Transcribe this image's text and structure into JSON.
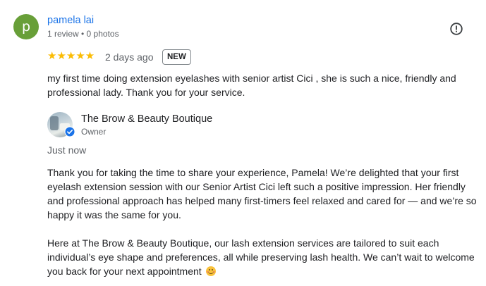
{
  "review": {
    "reviewer": {
      "initial": "p",
      "name": "pamela lai",
      "meta": "1 review • 0 photos",
      "avatar_color": "#689f38"
    },
    "rating": 5,
    "stars": "★★★★★",
    "date": "2 days ago",
    "badge": "NEW",
    "text": "my first time doing extension eyelashes with senior artist Cici , she is such a nice, friendly and professional lady. Thank you for your service.",
    "report_icon": "report-alert-icon"
  },
  "owner_reply": {
    "business_name": "The Brow & Beauty Boutique",
    "role": "Owner",
    "verified_icon": "verified-check-icon",
    "date": "Just now",
    "paragraph1": "Thank you for taking the time to share your experience, Pamela! We’re delighted that your first eyelash extension session with our Senior Artist Cici left such a positive impression. Her friendly and professional approach has helped many first-timers feel relaxed and cared for — and we’re so happy it was the same for you.",
    "paragraph2": "Here at The Brow & Beauty Boutique, our lash extension services are tailored to suit each individual’s eye shape and preferences, all while preserving lash health. We can’t wait to welcome you back for your next appointment",
    "emoji_icon": "smiling-face-emoji"
  },
  "colors": {
    "star": "#fbbc04",
    "link": "#1a73e8",
    "verified": "#1a73e8"
  }
}
